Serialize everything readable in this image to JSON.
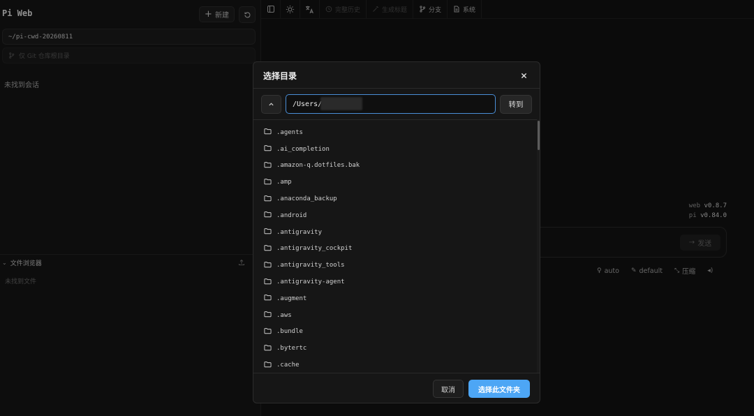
{
  "sidebar": {
    "app_title": "Pi Web",
    "new_button_label": "新建",
    "cwd": "~/pi-cwd-20260811",
    "git_hint": "仅 Git 仓库根目录",
    "no_session_text": "未找到会话",
    "file_browser": {
      "title": "文件浏览器",
      "empty_text": "未找到文件"
    }
  },
  "toolbar": {
    "items": [
      {
        "label": "完整历史",
        "icon": "history-icon",
        "disabled": true
      },
      {
        "label": "生成标题",
        "icon": "wand-icon",
        "disabled": true
      },
      {
        "label": "分支",
        "icon": "branch-icon",
        "disabled": false
      },
      {
        "label": "系统",
        "icon": "file-icon",
        "disabled": false
      }
    ]
  },
  "main": {
    "version_web_label": "web",
    "version_web": "v0.8.7",
    "version_pi_label": "pi",
    "version_pi": "v0.84.0",
    "send_label": "发送",
    "options": {
      "thinking": "auto",
      "tools": "default",
      "compress": "压缩"
    }
  },
  "dialog": {
    "title": "选择目录",
    "path_value": "/Users/",
    "goto_label": "转到",
    "directories": [
      ".agents",
      ".ai_completion",
      ".amazon-q.dotfiles.bak",
      ".amp",
      ".anaconda_backup",
      ".android",
      ".antigravity",
      ".antigravity_cockpit",
      ".antigravity_tools",
      ".antigravity-agent",
      ".augment",
      ".aws",
      ".bundle",
      ".bytertc",
      ".cache"
    ],
    "cancel_label": "取消",
    "confirm_label": "选择此文件夹"
  },
  "colors": {
    "accent": "#4da6f5",
    "input_focus": "#4a8fd8",
    "background": "#121212"
  }
}
